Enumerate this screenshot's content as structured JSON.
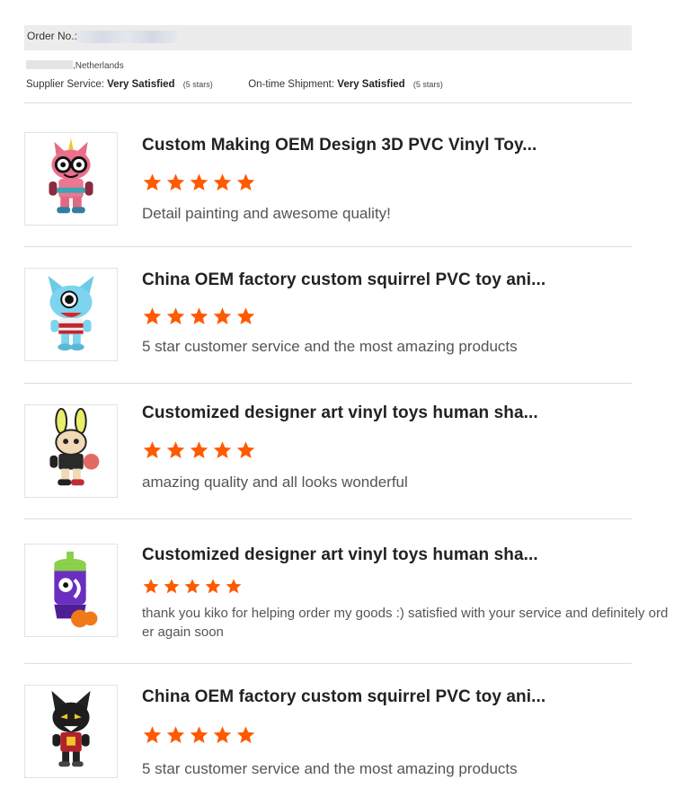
{
  "order": {
    "label": "Order No.:"
  },
  "location": {
    "country": ",Netherlands"
  },
  "ratings": {
    "supplier_label": "Supplier Service:",
    "supplier_value": "Very Satisfied",
    "supplier_stars": "(5 stars)",
    "shipment_label": "On-time Shipment:",
    "shipment_value": "Very Satisfied",
    "shipment_stars": "(5 stars)"
  },
  "colors": {
    "star": "#ff5a00",
    "rule": "#dddddd"
  },
  "reviews": [
    {
      "title": "Custom Making OEM Design 3D PVC Vinyl Toy...",
      "rating": 5,
      "comment": "Detail painting and awesome quality!",
      "image_icon": "pink-cat-toy-with-glasses"
    },
    {
      "title": "China OEM factory custom squirrel PVC toy ani...",
      "rating": 5,
      "comment": "5 star customer service and the most amazing products",
      "image_icon": "blue-cyclops-cat-toy"
    },
    {
      "title": "Customized designer art vinyl toys human sha...",
      "rating": 5,
      "comment": "amazing quality and all looks wonderful",
      "image_icon": "bunny-ear-boxer-toy"
    },
    {
      "title": "Customized designer art vinyl toys human sha...",
      "rating": 5,
      "comment": "thank you kiko for helping order my goods :) satisfied with your service and definitely order again soon",
      "image_icon": "purple-spray-can-toy"
    },
    {
      "title": "China OEM factory custom squirrel PVC toy ani...",
      "rating": 5,
      "comment": "5 star customer service and the most amazing products",
      "image_icon": "black-wolf-toy"
    }
  ]
}
